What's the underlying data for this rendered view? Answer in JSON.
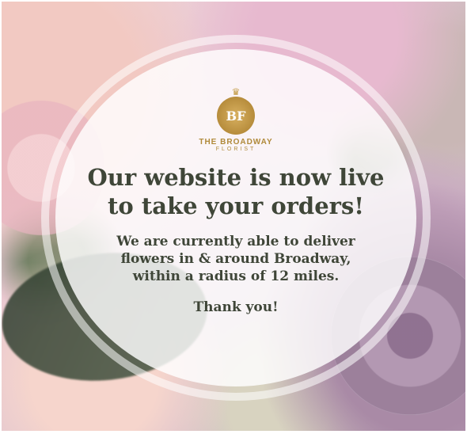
{
  "logo": {
    "initials": "BF",
    "brand_name": "THE BROADWAY",
    "brand_sub": "FLORIST"
  },
  "message": {
    "headline_line1": "Our website is now live",
    "headline_line2": "to take your orders!",
    "body_line1": "We are currently able to deliver",
    "body_line2": "flowers in & around Broadway,",
    "body_line3": "within a radius of 12 miles.",
    "thanks": "Thank you!"
  }
}
